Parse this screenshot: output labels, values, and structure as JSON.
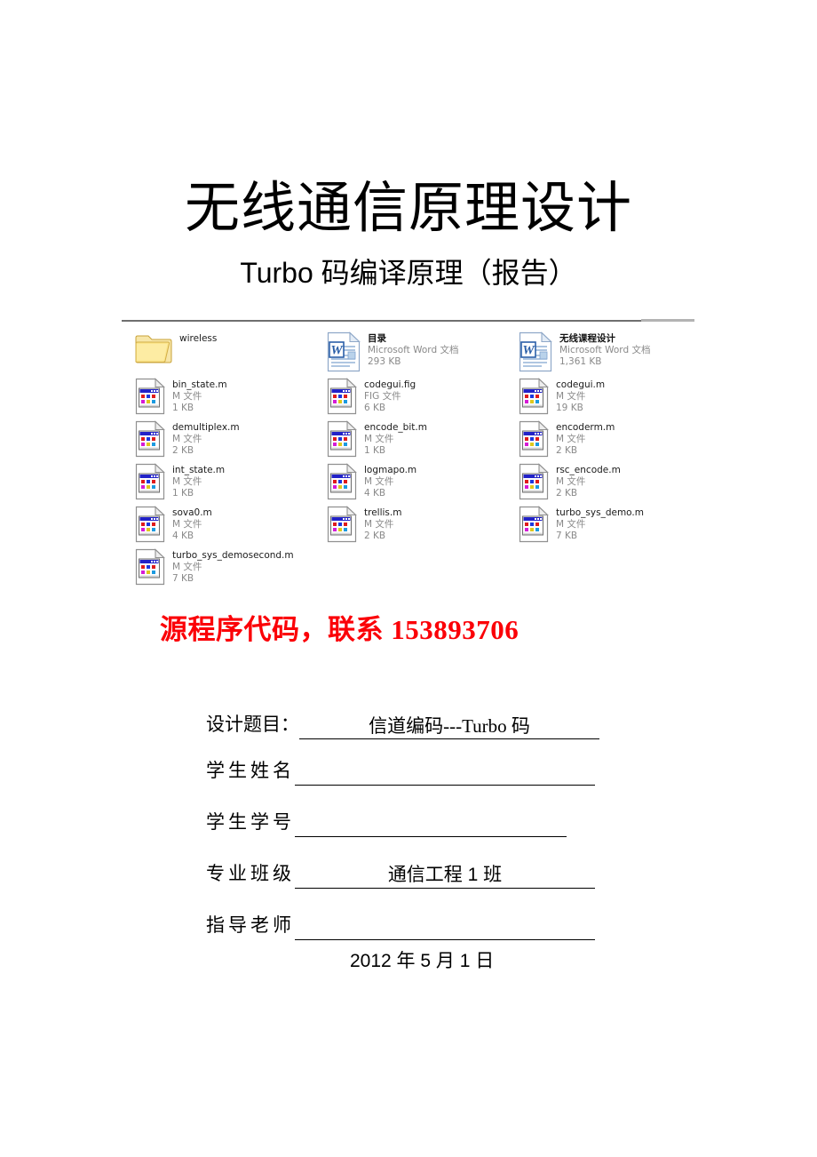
{
  "document": {
    "title": "无线通信原理设计",
    "subtitle": "Turbo 码编译原理（报告）"
  },
  "explorer": {
    "rows": [
      [
        {
          "icon": "folder-icon",
          "name": "wireless",
          "type": "",
          "size": "",
          "bold": false
        },
        {
          "icon": "word-doc-icon",
          "name": "目录",
          "type": "Microsoft Word 文档",
          "size": "293 KB",
          "bold": true
        },
        {
          "icon": "word-doc-icon",
          "name": "无线课程设计",
          "type": "Microsoft Word 文档",
          "size": "1,361 KB",
          "bold": true
        }
      ],
      [
        {
          "icon": "m-file-icon",
          "name": "bin_state.m",
          "type": "M 文件",
          "size": "1 KB",
          "bold": false
        },
        {
          "icon": "m-file-icon",
          "name": "codegui.fig",
          "type": "FIG 文件",
          "size": "6 KB",
          "bold": false
        },
        {
          "icon": "m-file-icon",
          "name": "codegui.m",
          "type": "M 文件",
          "size": "19 KB",
          "bold": false
        }
      ],
      [
        {
          "icon": "m-file-icon",
          "name": "demultiplex.m",
          "type": "M 文件",
          "size": "2 KB",
          "bold": false
        },
        {
          "icon": "m-file-icon",
          "name": "encode_bit.m",
          "type": "M 文件",
          "size": "1 KB",
          "bold": false
        },
        {
          "icon": "m-file-icon",
          "name": "encoderm.m",
          "type": "M 文件",
          "size": "2 KB",
          "bold": false
        }
      ],
      [
        {
          "icon": "m-file-icon",
          "name": "int_state.m",
          "type": "M 文件",
          "size": "1 KB",
          "bold": false
        },
        {
          "icon": "m-file-icon",
          "name": "logmapo.m",
          "type": "M 文件",
          "size": "4 KB",
          "bold": false
        },
        {
          "icon": "m-file-icon",
          "name": "rsc_encode.m",
          "type": "M 文件",
          "size": "2 KB",
          "bold": false
        }
      ],
      [
        {
          "icon": "m-file-icon",
          "name": "sova0.m",
          "type": "M 文件",
          "size": "4 KB",
          "bold": false
        },
        {
          "icon": "m-file-icon",
          "name": "trellis.m",
          "type": "M 文件",
          "size": "2 KB",
          "bold": false
        },
        {
          "icon": "m-file-icon",
          "name": "turbo_sys_demo.m",
          "type": "M 文件",
          "size": "7 KB",
          "bold": false
        }
      ],
      [
        {
          "icon": "m-file-icon",
          "name": "turbo_sys_demosecond.m",
          "type": "M 文件",
          "size": "7 KB",
          "bold": false
        },
        {
          "icon": "",
          "name": "",
          "type": "",
          "size": "",
          "bold": false
        },
        {
          "icon": "",
          "name": "",
          "type": "",
          "size": "",
          "bold": false
        }
      ]
    ]
  },
  "notice": {
    "text": "源程序代码，联系 153893706",
    "color": "#fb0007"
  },
  "form": {
    "fields": [
      {
        "label": "设计题目：",
        "value": "信道编码---Turbo 码"
      },
      {
        "label": "学生姓名",
        "value": ""
      },
      {
        "label": "学生学号",
        "value": ""
      },
      {
        "label": "专业班级",
        "value": "通信工程 1 班"
      },
      {
        "label": "指导老师",
        "value": ""
      }
    ],
    "date": "2012 年 5 月 1 日"
  }
}
